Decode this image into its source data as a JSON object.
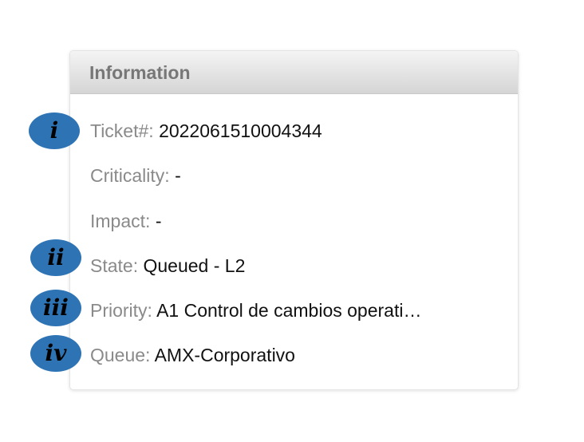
{
  "panel": {
    "title": "Information",
    "fields": [
      {
        "label": "Ticket#:",
        "value": "2022061510004344"
      },
      {
        "label": "Criticality:",
        "value": "-"
      },
      {
        "label": "Impact:",
        "value": "-"
      },
      {
        "label": "State:",
        "value": "Queued - L2"
      },
      {
        "label": "Priority:",
        "value": "A1 Control de cambios operati…"
      },
      {
        "label": "Queue:",
        "value": "AMX-Corporativo"
      }
    ]
  },
  "markers": [
    "i",
    "ii",
    "iii",
    "iv"
  ],
  "colors": {
    "marker_fill": "#2e74b5",
    "label": "#8a8a8a",
    "value": "#111111",
    "header_text": "#777777"
  }
}
